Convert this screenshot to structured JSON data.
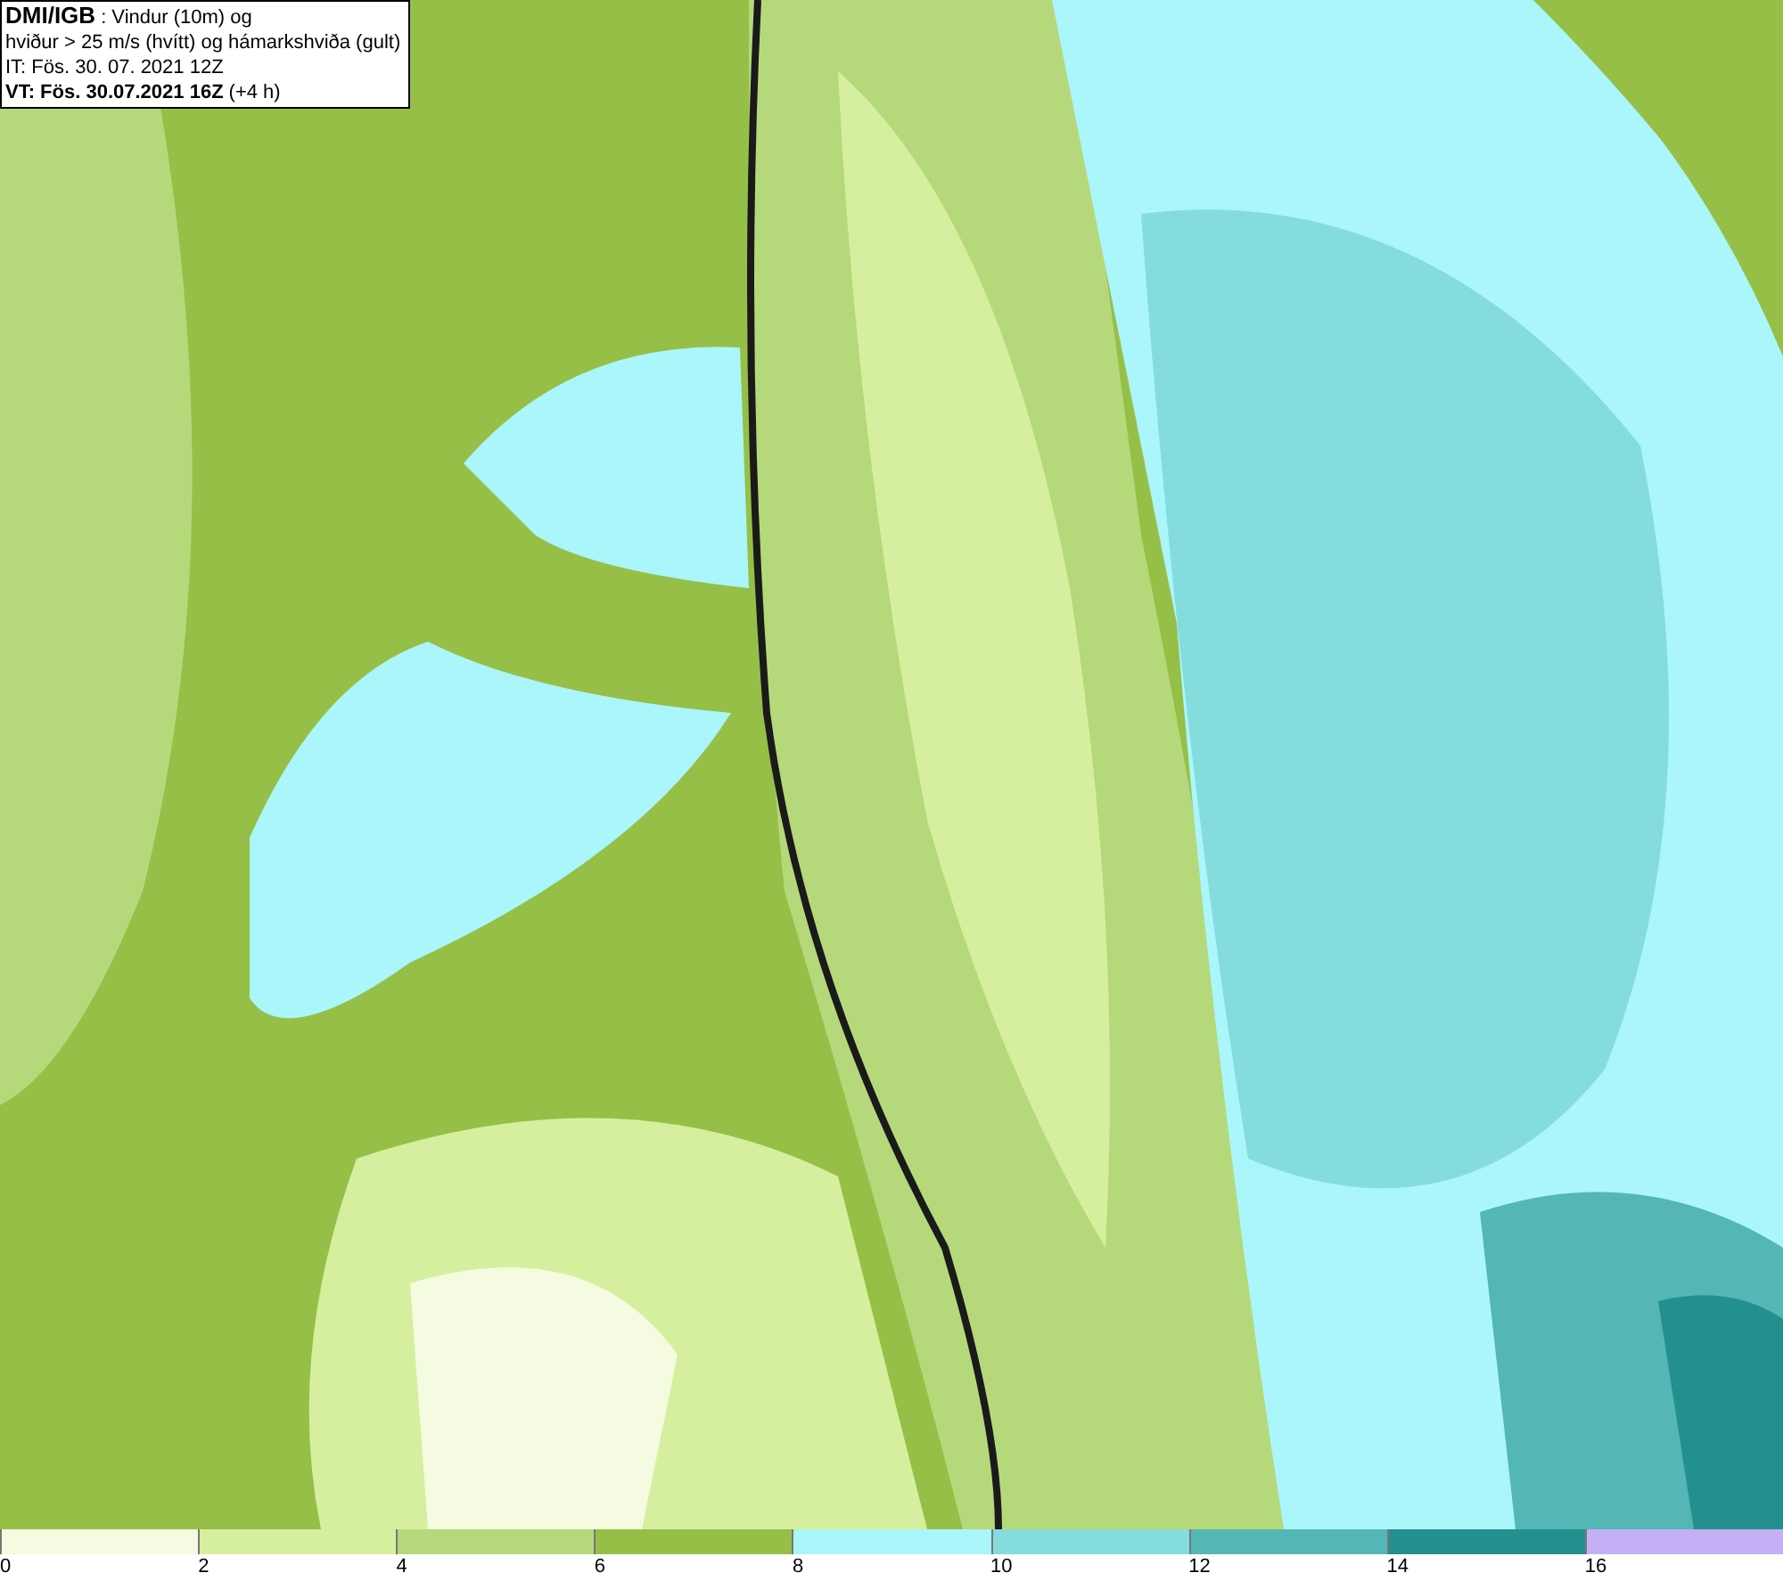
{
  "header": {
    "source": "DMI/IGB",
    "title": ": Vindur (10m) og",
    "subtitle": "hviður > 25 m/s (hvítt) og hámarkshviða (gult)",
    "issue_time": "IT: Fös. 30. 07. 2021 12Z",
    "valid_time": "VT: Fös. 30.07.2021 16Z",
    "lead": "(+4 h)"
  },
  "legend": [
    {
      "label": "0",
      "color": "#f4fbe0"
    },
    {
      "label": "2",
      "color": "#d6ef9e"
    },
    {
      "label": "4",
      "color": "#b5d97a"
    },
    {
      "label": "6",
      "color": "#96bf48"
    },
    {
      "label": "8",
      "color": "#aaf6fa"
    },
    {
      "label": "10",
      "color": "#85dcdc"
    },
    {
      "label": "12",
      "color": "#55b6b6"
    },
    {
      "label": "14",
      "color": "#248f8f"
    },
    {
      "label": "16",
      "color": "#c3b0f5"
    }
  ]
}
